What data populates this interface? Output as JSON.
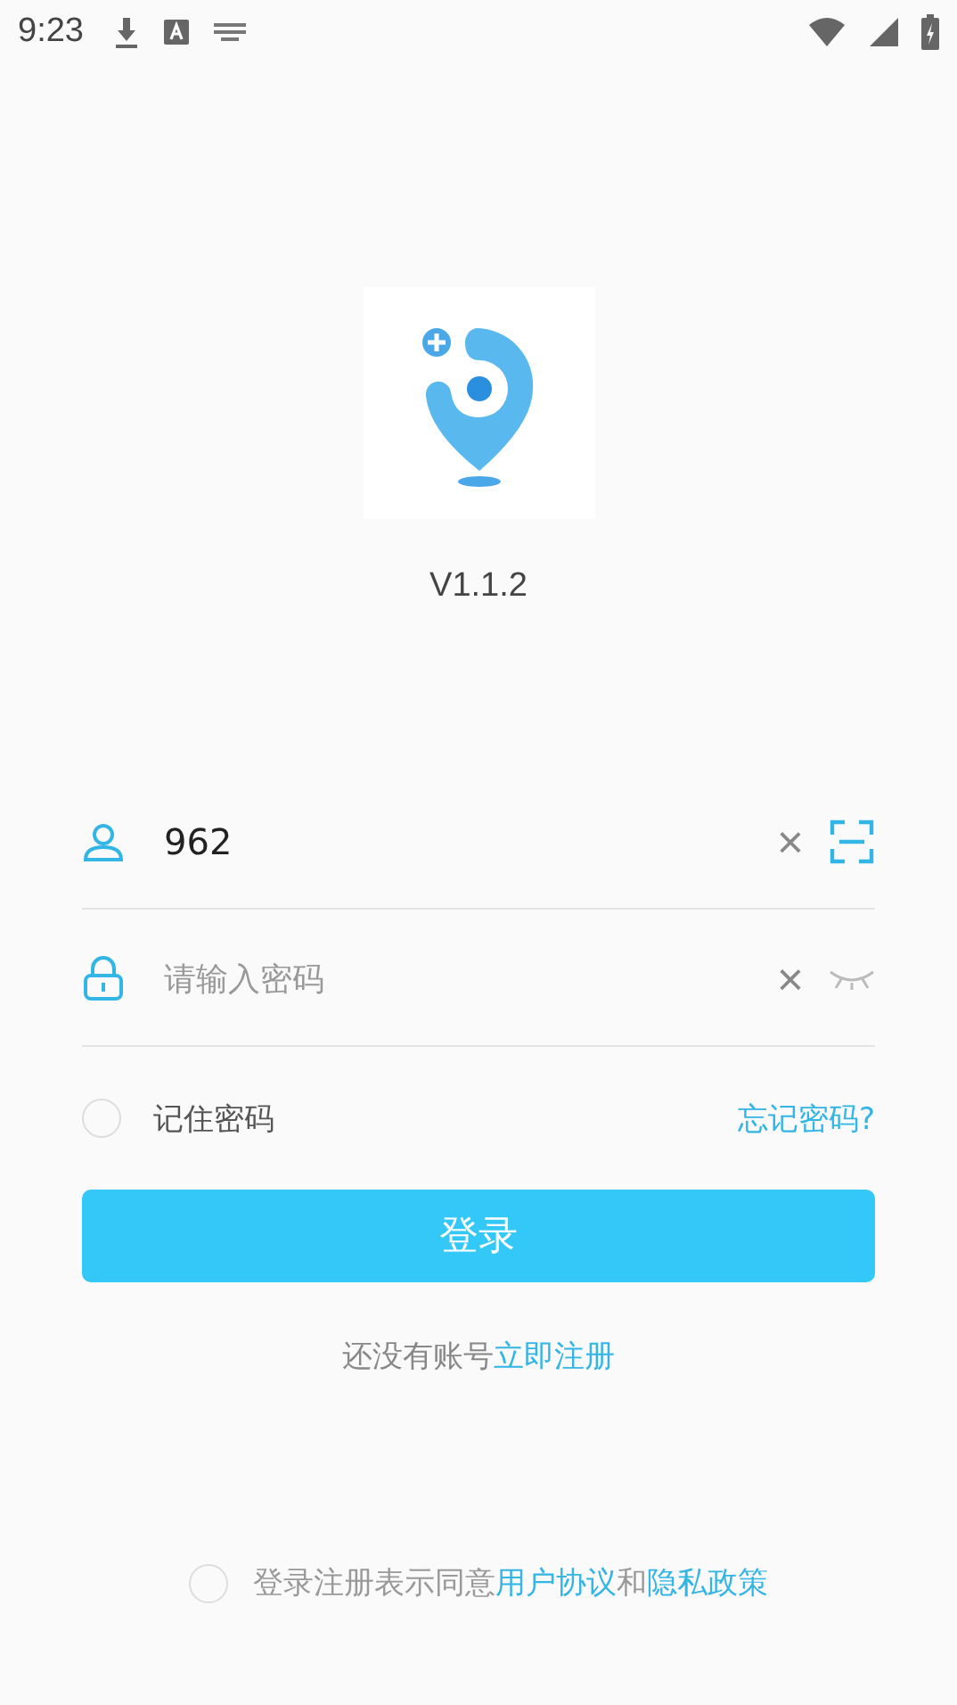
{
  "status_bar": {
    "time": "9:23"
  },
  "app": {
    "version": "V1.1.2"
  },
  "username": {
    "value": "962",
    "clear": "×"
  },
  "password": {
    "placeholder": "请输入密码",
    "clear": "×"
  },
  "remember": {
    "label": "记住密码",
    "checked": false
  },
  "forgot": "忘记密码?",
  "login_button": "登录",
  "register": {
    "prompt": "还没有账号",
    "link": "立即注册"
  },
  "agreement": {
    "checked": false,
    "text": "登录注册表示同意",
    "terms": "用户协议",
    "joiner": "和",
    "privacy": "隐私政策"
  }
}
